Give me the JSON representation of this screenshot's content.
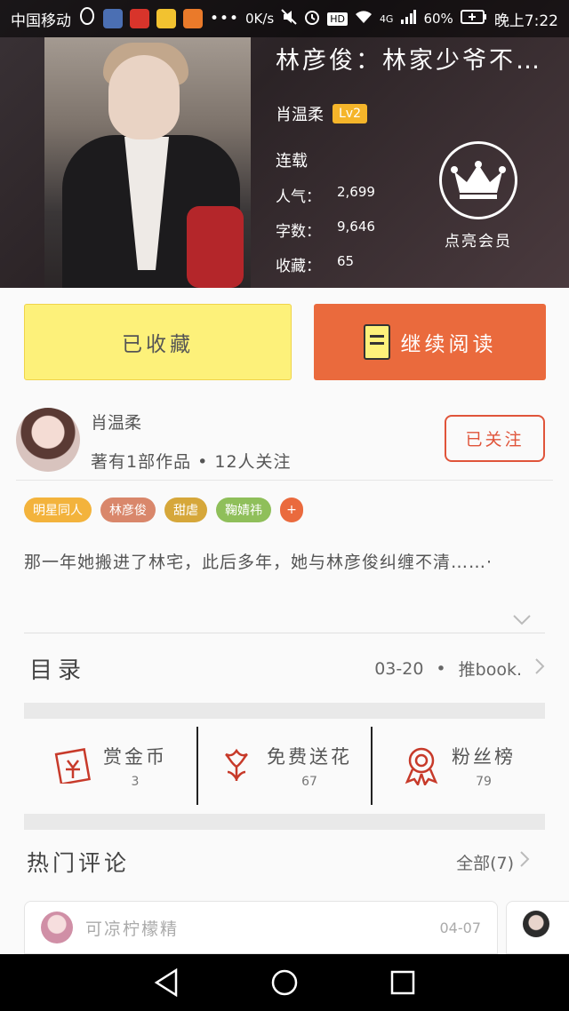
{
  "status_bar": {
    "carrier": "中国移动",
    "more": "•••",
    "speed": "0K/s",
    "network": "4G",
    "battery": "60%",
    "time": "晚上7:22"
  },
  "book": {
    "title": "林彦俊：林家少爷不…",
    "author": "肖温柔",
    "level": "Lv2",
    "status": "连载",
    "stats": [
      {
        "label": "人气：",
        "value": "2,699"
      },
      {
        "label": "字数：",
        "value": "9,646"
      },
      {
        "label": "收藏：",
        "value": "65"
      }
    ],
    "vip_label": "点亮会员"
  },
  "actions": {
    "collect_label": "已收藏",
    "read_label": "继续阅读"
  },
  "author_block": {
    "name": "肖温柔",
    "meta": "著有1部作品 • 12人关注",
    "follow_label": "已关注"
  },
  "tags": [
    {
      "label": "明星同人",
      "color": "#f3b33c"
    },
    {
      "label": "林彦俊",
      "color": "#d9876b"
    },
    {
      "label": "甜虐",
      "color": "#d6a73a"
    },
    {
      "label": "鞠婧祎",
      "color": "#8fbf5a"
    },
    {
      "label": "+",
      "color": "#ea6a3d"
    }
  ],
  "intro": "那一年她搬进了林宅，此后多年，她与林彦俊纠缠不清……·",
  "toc": {
    "title": "目录",
    "date": "03-20",
    "dot": "•",
    "source": "推book."
  },
  "gifts": [
    {
      "label": "赏金币",
      "value": "3",
      "icon": "red-envelope-icon",
      "glyph": "🧧"
    },
    {
      "label": "免费送花",
      "value": "67",
      "icon": "flower-icon",
      "glyph": "❀"
    },
    {
      "label": "粉丝榜",
      "value": "79",
      "icon": "medal-icon",
      "glyph": "🏅"
    }
  ],
  "comments": {
    "title": "热门评论",
    "all_label": "全部(7)",
    "first": {
      "user": "可凉柠檬精",
      "date": "04-07"
    }
  },
  "colors": {
    "accent": "#ea6a3d",
    "collect_bg": "#fdf17a",
    "follow": "#e0543a"
  }
}
